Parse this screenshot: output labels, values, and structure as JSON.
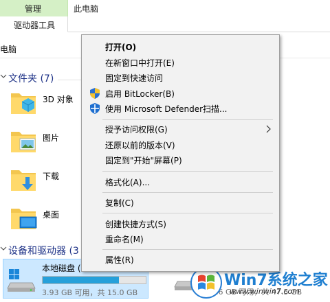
{
  "ribbon": {
    "tab_manage": "管理",
    "tab_thispc": "此电脑",
    "tab_drive_tools": "驱动器工具",
    "accent_color": "#d5f0c6"
  },
  "address_bar": {
    "text": "电脑"
  },
  "sections": {
    "folders": "文件夹 (7)",
    "devices": "设备和驱动器 (3"
  },
  "folders": [
    {
      "label": "3D 对象",
      "icon": "3d-objects-folder-icon"
    },
    {
      "label": "图片",
      "icon": "pictures-folder-icon"
    },
    {
      "label": "下载",
      "icon": "downloads-folder-icon"
    },
    {
      "label": "桌面",
      "icon": "desktop-folder-icon"
    }
  ],
  "drives": {
    "c": {
      "name": "本地磁盘 (",
      "free_text": "3.93 GB 可用，共 15.0 GB",
      "used_fraction": 0.74
    },
    "d": {
      "free_text": "30.6 GB 可用，共 47.5 GB"
    }
  },
  "context_menu": {
    "open": "打开(O)",
    "open_new_window": "在新窗口中打开(E)",
    "pin_quick_access": "固定到快速访问",
    "bitlocker": "启用 BitLocker(B)",
    "defender": "使用 Microsoft Defender扫描...",
    "give_access": "授予访问权限(G)",
    "restore_previous": "还原以前的版本(V)",
    "pin_start": "固定到\"开始\"屏幕(P)",
    "format": "格式化(A)...",
    "copy": "复制(C)",
    "create_shortcut": "创建快捷方式(S)",
    "rename": "重命名(M)",
    "properties": "属性(R)"
  },
  "watermark": {
    "text": "Win7系统之家",
    "url": "www.winwin7.com"
  }
}
